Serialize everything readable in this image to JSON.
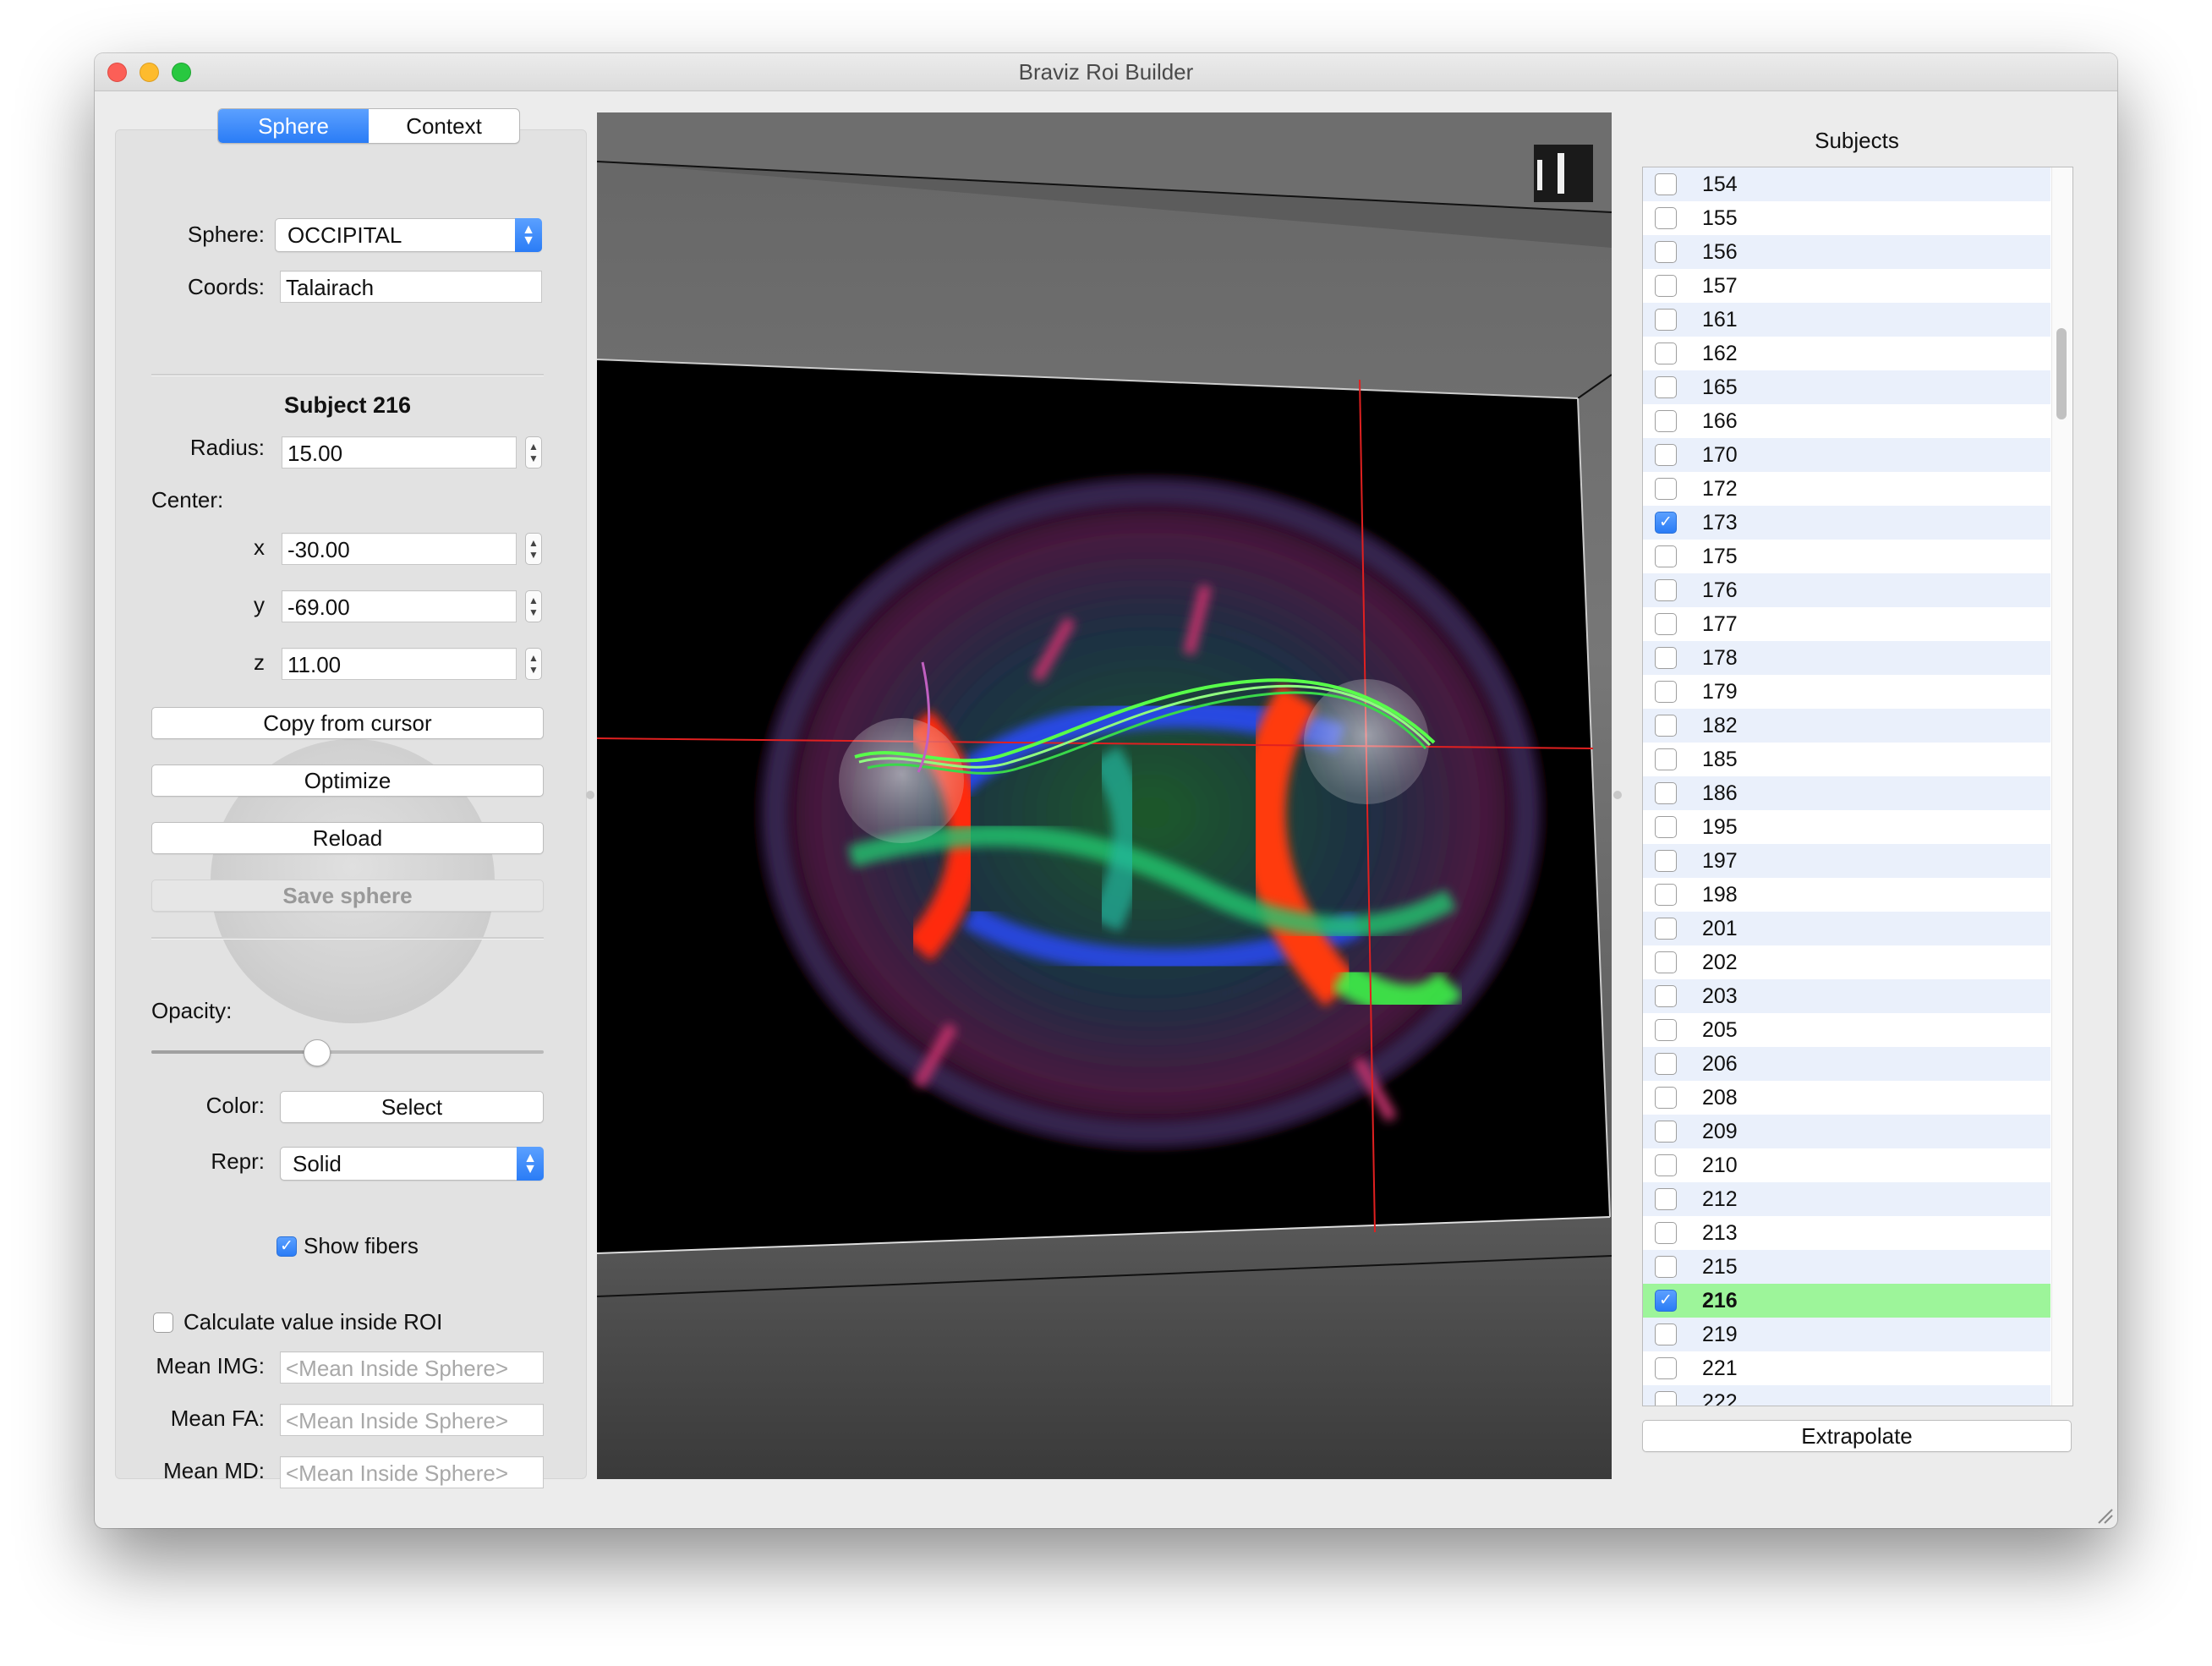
{
  "window": {
    "title": "Braviz Roi Builder"
  },
  "tabs": [
    {
      "label": "Sphere",
      "active": true
    },
    {
      "label": "Context",
      "active": false
    }
  ],
  "sphere_form": {
    "sphere_label": "Sphere:",
    "sphere_value": "OCCIPITAL",
    "coords_label": "Coords:",
    "coords_value": "Talairach",
    "subject_title": "Subject 216",
    "radius_label": "Radius:",
    "radius_value": "15.00",
    "center_label": "Center:",
    "x_label": "x",
    "x_value": "-30.00",
    "y_label": "y",
    "y_value": "-69.00",
    "z_label": "z",
    "z_value": "11.00",
    "copy_button": "Copy from cursor",
    "optimize_button": "Optimize",
    "reload_button": "Reload",
    "save_button": "Save sphere",
    "opacity_label": "Opacity:",
    "opacity_level": 0.42,
    "color_label": "Color:",
    "color_button": "Select",
    "repr_label": "Repr:",
    "repr_value": "Solid",
    "show_fibers_label": "Show fibers",
    "show_fibers_checked": true,
    "calc_label": "Calculate value inside ROI",
    "calc_checked": false,
    "mean_img_label": "Mean IMG:",
    "mean_fa_label": "Mean FA:",
    "mean_md_label": "Mean MD:",
    "mean_placeholder": "<Mean Inside Sphere>"
  },
  "subjects": {
    "title": "Subjects",
    "items": [
      {
        "id": "154",
        "checked": false
      },
      {
        "id": "155",
        "checked": false
      },
      {
        "id": "156",
        "checked": false
      },
      {
        "id": "157",
        "checked": false
      },
      {
        "id": "161",
        "checked": false
      },
      {
        "id": "162",
        "checked": false
      },
      {
        "id": "165",
        "checked": false
      },
      {
        "id": "166",
        "checked": false
      },
      {
        "id": "170",
        "checked": false
      },
      {
        "id": "172",
        "checked": false
      },
      {
        "id": "173",
        "checked": true
      },
      {
        "id": "175",
        "checked": false
      },
      {
        "id": "176",
        "checked": false
      },
      {
        "id": "177",
        "checked": false
      },
      {
        "id": "178",
        "checked": false
      },
      {
        "id": "179",
        "checked": false
      },
      {
        "id": "182",
        "checked": false
      },
      {
        "id": "185",
        "checked": false
      },
      {
        "id": "186",
        "checked": false
      },
      {
        "id": "195",
        "checked": false
      },
      {
        "id": "197",
        "checked": false
      },
      {
        "id": "198",
        "checked": false
      },
      {
        "id": "201",
        "checked": false
      },
      {
        "id": "202",
        "checked": false
      },
      {
        "id": "203",
        "checked": false
      },
      {
        "id": "205",
        "checked": false
      },
      {
        "id": "206",
        "checked": false
      },
      {
        "id": "208",
        "checked": false
      },
      {
        "id": "209",
        "checked": false
      },
      {
        "id": "210",
        "checked": false
      },
      {
        "id": "212",
        "checked": false
      },
      {
        "id": "213",
        "checked": false
      },
      {
        "id": "215",
        "checked": false
      },
      {
        "id": "216",
        "checked": true,
        "selected": true
      },
      {
        "id": "219",
        "checked": false
      },
      {
        "id": "221",
        "checked": false
      },
      {
        "id": "222",
        "checked": false
      }
    ],
    "extrapolate_button": "Extrapolate"
  },
  "colors": {
    "accent": "#2a7cf6",
    "selected_row": "#9df59a",
    "cursor_line": "#e02020"
  }
}
